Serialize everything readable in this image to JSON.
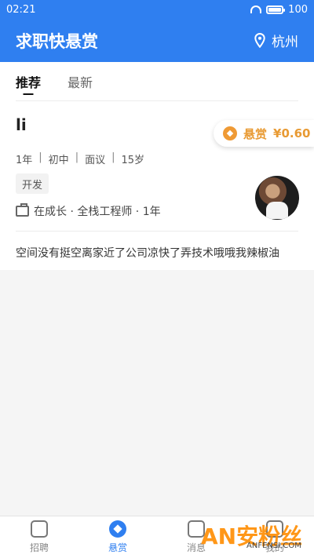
{
  "status": {
    "time": "02:21",
    "battery": "100"
  },
  "header": {
    "title": "求职快悬赏",
    "location": "杭州"
  },
  "tabs": [
    {
      "label": "推荐",
      "active": true
    },
    {
      "label": "最新",
      "active": false
    }
  ],
  "card": {
    "name": "li",
    "reward_label": "悬赏",
    "reward_amount": "¥0.60",
    "meta": [
      "1年",
      "初中",
      "面议",
      "15岁"
    ],
    "tag": "开发",
    "work": "在成长 · 全栈工程师 · 1年",
    "description": "空间没有挺空离家近了公司凉快了弄技术哦哦我辣椒油"
  },
  "bottom_nav": [
    {
      "label": "招聘",
      "icon": "briefcase-icon",
      "active": false
    },
    {
      "label": "悬赏",
      "icon": "reward-icon",
      "active": true
    },
    {
      "label": "消息",
      "icon": "message-icon",
      "active": false
    },
    {
      "label": "我的",
      "icon": "profile-icon",
      "active": false
    }
  ],
  "watermark": {
    "logo": "AN安粉丝",
    "url": "ANFENSI.COM"
  },
  "colors": {
    "primary": "#2f7ff0",
    "reward": "#e89a33"
  }
}
